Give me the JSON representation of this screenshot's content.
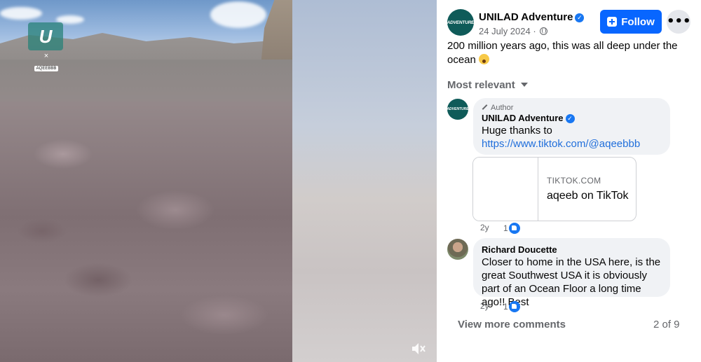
{
  "video": {
    "watermark_logo": "U",
    "watermark_x": "×",
    "watermark_tag": "AQEEBBB",
    "mute_icon": "speaker-muted-icon"
  },
  "post": {
    "page_name": "UNILAD Adventure",
    "avatar_text": "ADVENTURE",
    "date": "24 July 2024",
    "separator": "·",
    "follow_label": "Follow",
    "more_label": "•••",
    "caption": "200 million years ago, this was all deep under the ocean"
  },
  "comments": {
    "sort_label": "Most relevant",
    "items": [
      {
        "author_tag": "Author",
        "name": "UNILAD Adventure",
        "avatar_text": "ADVENTURE",
        "text": "Huge thanks to",
        "link": "https://www.tiktok.com/@aqeebbb",
        "card_domain": "TIKTOK.COM",
        "card_title": "aqeeb on TikTok",
        "age": "2y",
        "likes": "1"
      },
      {
        "name": "Richard Doucette",
        "text": "Closer to home in the USA here, is the great Southwest USA it is obviously part of an Ocean Floor a long time ago!! Best",
        "age": "2y",
        "likes": "1"
      }
    ],
    "view_more_label": "View more comments",
    "count_label": "2 of 9"
  },
  "colors": {
    "accent": "#0866ff",
    "link": "#216fdb",
    "secondary_text": "#65676b",
    "bubble": "#f0f2f5",
    "brand_teal": "#0f5b59"
  }
}
